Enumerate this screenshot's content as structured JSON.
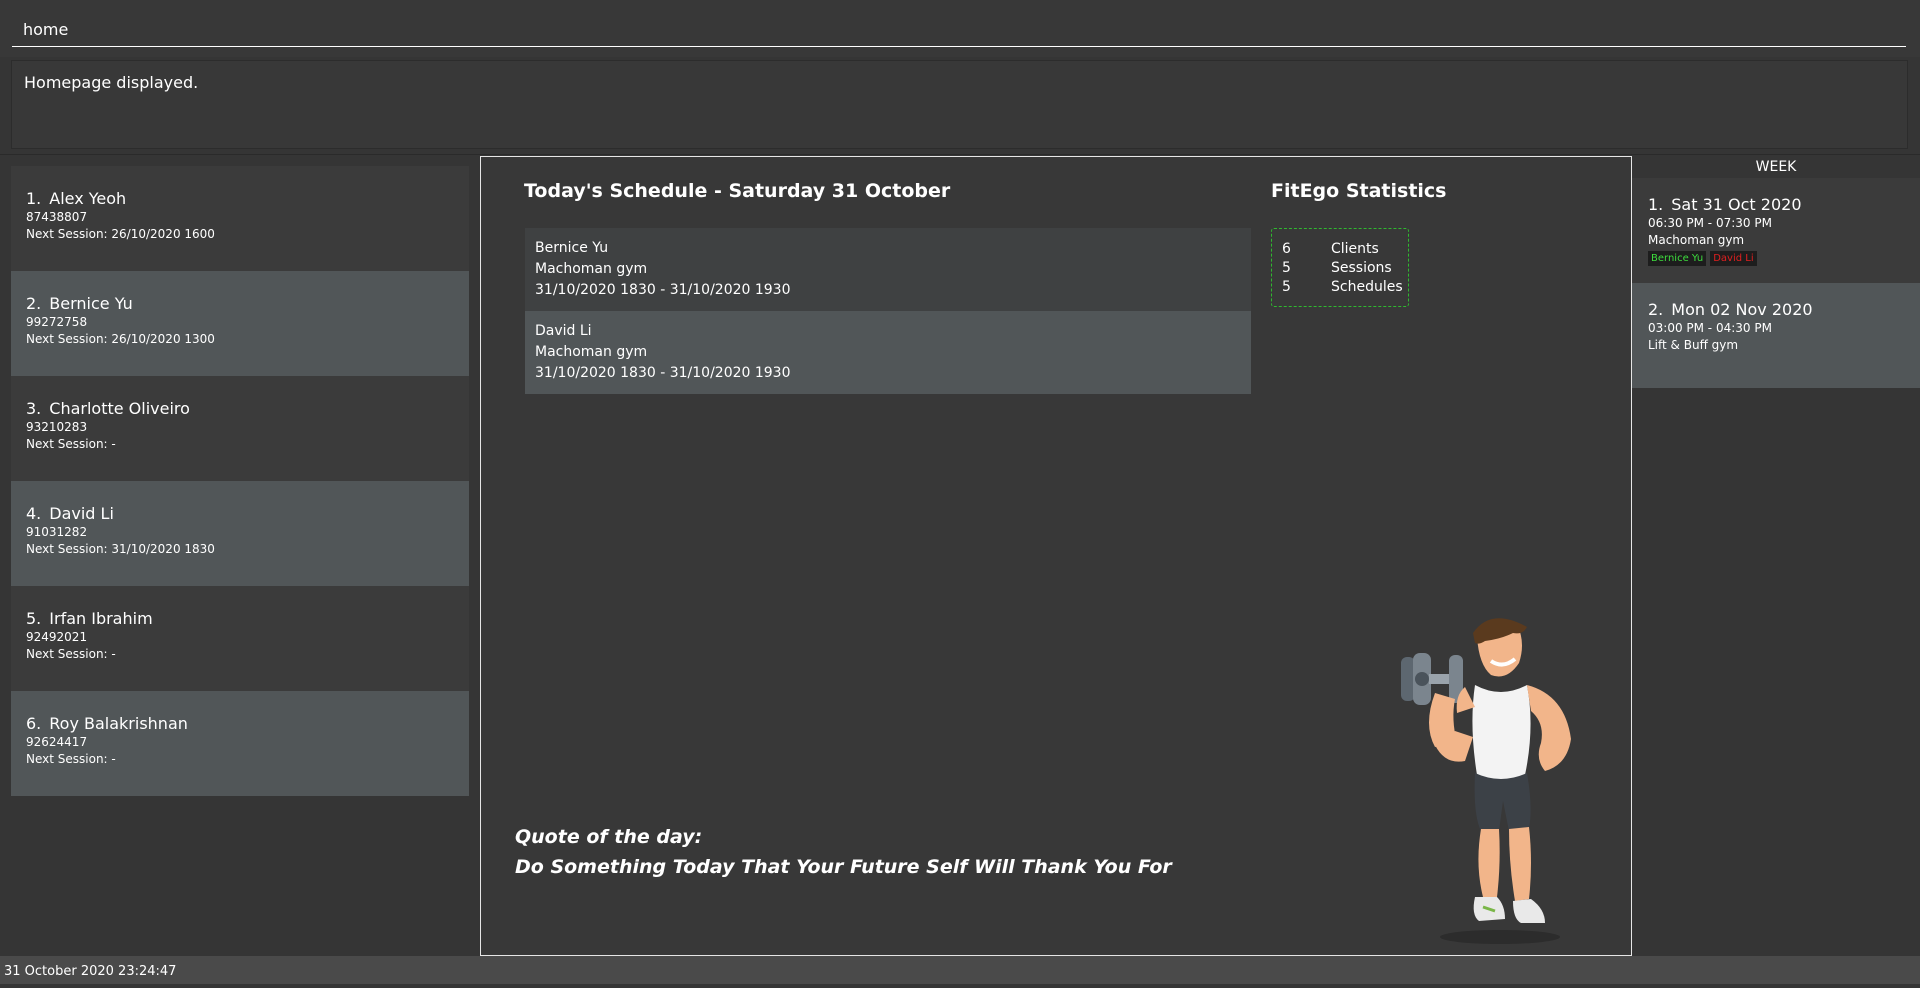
{
  "command": {
    "value": "home"
  },
  "result": {
    "text": "Homepage displayed."
  },
  "clients": [
    {
      "index": "1.",
      "name": "Alex Yeoh",
      "phone": "87438807",
      "next_session": "Next Session: 26/10/2020 1600"
    },
    {
      "index": "2.",
      "name": "Bernice Yu",
      "phone": "99272758",
      "next_session": "Next Session: 26/10/2020 1300"
    },
    {
      "index": "3.",
      "name": "Charlotte Oliveiro",
      "phone": "93210283",
      "next_session": "Next Session:  -"
    },
    {
      "index": "4.",
      "name": "David Li",
      "phone": "91031282",
      "next_session": "Next Session: 31/10/2020 1830"
    },
    {
      "index": "5.",
      "name": "Irfan Ibrahim",
      "phone": "92492021",
      "next_session": "Next Session:  -"
    },
    {
      "index": "6.",
      "name": "Roy Balakrishnan",
      "phone": "92624417",
      "next_session": "Next Session:  -"
    }
  ],
  "schedule": {
    "title": "Today's Schedule - Saturday 31 October",
    "items": [
      {
        "client": "Bernice Yu",
        "gym": "Machoman gym",
        "time": "31/10/2020 1830 - 31/10/2020 1930"
      },
      {
        "client": "David Li",
        "gym": "Machoman gym",
        "time": "31/10/2020 1830 - 31/10/2020 1930"
      }
    ]
  },
  "stats": {
    "title": "FitEgo Statistics",
    "rows": [
      {
        "value": "6",
        "label": "Clients"
      },
      {
        "value": "5",
        "label": "Sessions"
      },
      {
        "value": "5",
        "label": "Schedules"
      }
    ],
    "border_color": "#2fb82f"
  },
  "quote": {
    "label": "Quote of the day:",
    "text": "Do Something Today That Your Future Self Will Thank You For"
  },
  "week": {
    "header": "WEEK",
    "sessions": [
      {
        "index": "1.",
        "date": "Sat 31 Oct 2020",
        "time": "06:30 PM - 07:30 PM",
        "gym": "Machoman gym",
        "tags": [
          {
            "name": "Bernice Yu",
            "color": "#3ddc3d"
          },
          {
            "name": "David Li",
            "color": "#e02020"
          }
        ]
      },
      {
        "index": "2.",
        "date": "Mon 02 Nov 2020",
        "time": "03:00 PM - 04:30 PM",
        "gym": "Lift & Buff gym",
        "tags": []
      }
    ]
  },
  "status": {
    "datetime": "31 October 2020 23:24:47"
  }
}
